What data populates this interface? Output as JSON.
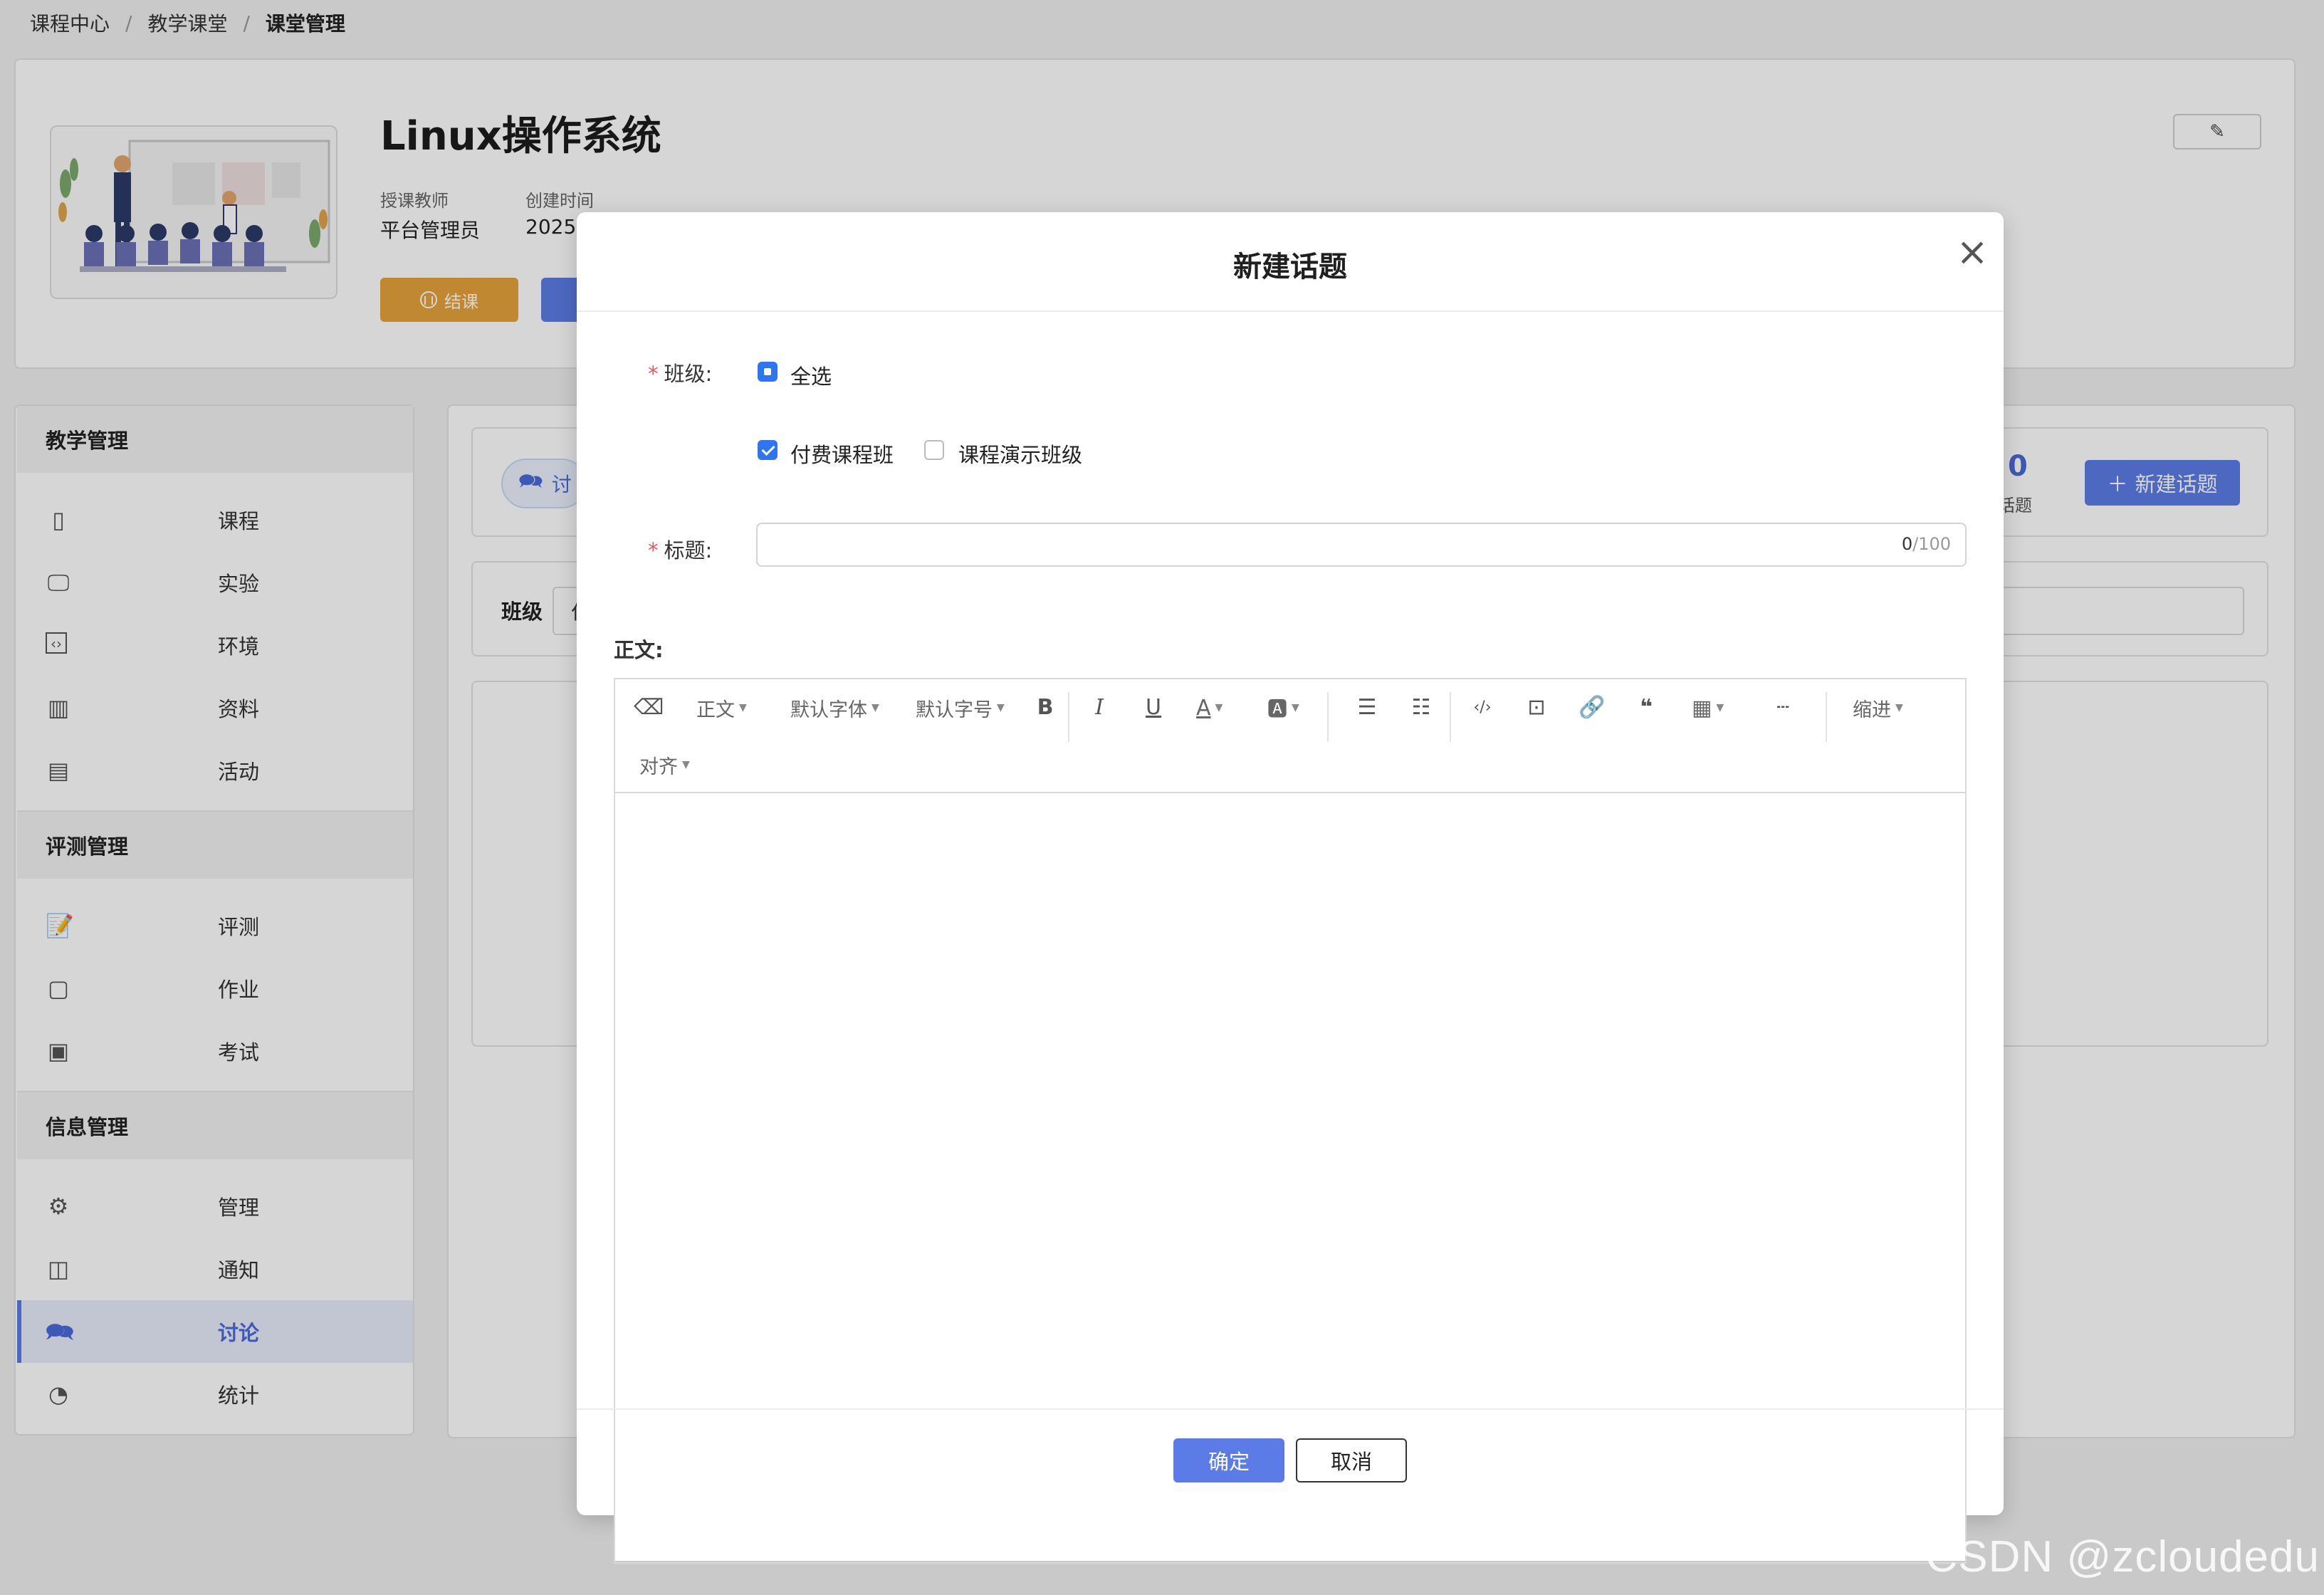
{
  "breadcrumb": {
    "items": [
      "课程中心",
      "教学课堂",
      "课堂管理"
    ],
    "separator": "/"
  },
  "course": {
    "title": "Linux操作系统",
    "teacher_label": "授课教师",
    "teacher_value": "平台管理员",
    "created_label": "创建时间",
    "created_value": "2025-",
    "end_button": "结课"
  },
  "sidebar": {
    "groups": [
      {
        "title": "教学管理",
        "items": [
          {
            "label": "课程",
            "icon": "book-icon"
          },
          {
            "label": "实验",
            "icon": "monitor-icon"
          },
          {
            "label": "环境",
            "icon": "code-window-icon"
          },
          {
            "label": "资料",
            "icon": "bar-chart-icon"
          },
          {
            "label": "活动",
            "icon": "calendar-icon"
          }
        ]
      },
      {
        "title": "评测管理",
        "items": [
          {
            "label": "评测",
            "icon": "edit-doc-icon"
          },
          {
            "label": "作业",
            "icon": "check-doc-icon"
          },
          {
            "label": "考试",
            "icon": "exam-doc-icon"
          }
        ]
      },
      {
        "title": "信息管理",
        "items": [
          {
            "label": "管理",
            "icon": "gear-icon"
          },
          {
            "label": "通知",
            "icon": "notification-icon"
          },
          {
            "label": "讨论",
            "icon": "chat-icon",
            "active": true
          },
          {
            "label": "统计",
            "icon": "pie-chart-icon"
          }
        ]
      }
    ]
  },
  "main": {
    "tab_label": "讨",
    "stat_value": "0",
    "stat_label": "的话题",
    "new_topic_button": "新建话题",
    "filter_label": "班级",
    "filter_value": "付"
  },
  "modal": {
    "title": "新建话题",
    "class_label": "班级:",
    "select_all": "全选",
    "classes": [
      {
        "label": "付费课程班",
        "checked": true
      },
      {
        "label": "课程演示班级",
        "checked": false
      }
    ],
    "title_label": "标题:",
    "title_value": "",
    "title_counter_current": "0",
    "title_counter_max": "/100",
    "body_label": "正文:",
    "toolbar": {
      "paragraph": "正文",
      "font_family": "默认字体",
      "font_size": "默认字号",
      "indent": "缩进",
      "align": "对齐"
    },
    "ok_button": "确定",
    "cancel_button": "取消"
  },
  "watermark": "CSDN @zcloudedu",
  "colors": {
    "primary": "#5b7ce6",
    "checkbox": "#2f74f0",
    "warning": "#e6a23c",
    "required": "#f05454"
  }
}
